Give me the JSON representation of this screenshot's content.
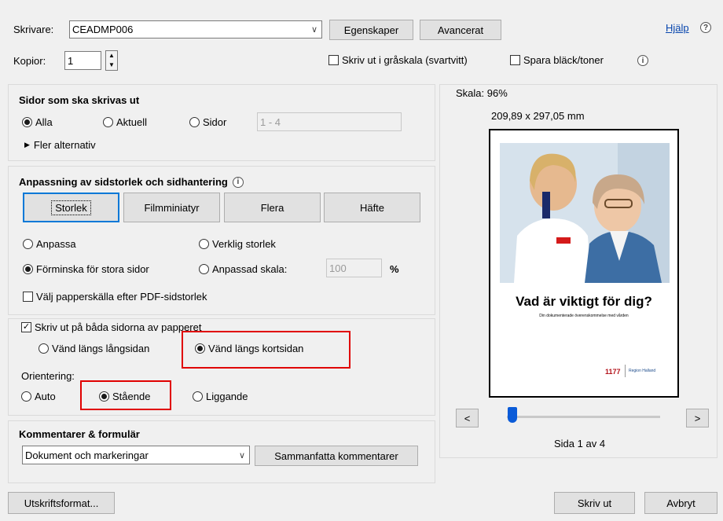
{
  "printer": {
    "label": "Skrivare:",
    "value": "CEADMP006",
    "properties_button": "Egenskaper",
    "advanced_button": "Avancerat",
    "help_link": "Hjälp",
    "help_icon": "?"
  },
  "copies": {
    "label": "Kopior:",
    "value": "1",
    "grayscale_label": "Skriv ut i gråskala (svartvitt)",
    "save_ink_label": "Spara bläck/toner",
    "info_icon": "i"
  },
  "pages_to_print": {
    "title": "Sidor som ska skrivas ut",
    "options": [
      "Alla",
      "Aktuell",
      "Sidor"
    ],
    "selected": "Alla",
    "pages_placeholder": "1 - 4",
    "more_options": "Fler alternativ"
  },
  "page_sizing": {
    "title": "Anpassning av sidstorlek och sidhantering",
    "info_icon": "i",
    "tabs": [
      "Storlek",
      "Filmminiatyr",
      "Flera",
      "Häfte"
    ],
    "active_tab": "Storlek",
    "options": {
      "fit": "Anpassa",
      "actual": "Verklig storlek",
      "shrink": "Förminska för stora sidor",
      "custom": "Anpassad skala:"
    },
    "selected": "Förminska för stora sidor",
    "custom_scale_value": "100",
    "percent": "%",
    "paper_source_label": "Välj papperskälla efter PDF-sidstorlek"
  },
  "duplex": {
    "label": "Skriv ut på båda sidorna av papperet",
    "checked": true,
    "flip_long": "Vänd längs långsidan",
    "flip_short": "Vänd längs kortsidan",
    "selected": "Vänd längs kortsidan"
  },
  "orientation": {
    "label": "Orientering:",
    "options": [
      "Auto",
      "Stående",
      "Liggande"
    ],
    "selected": "Stående"
  },
  "comments": {
    "title": "Kommentarer & formulär",
    "value": "Dokument och markeringar",
    "summarize_button": "Sammanfatta kommentarer"
  },
  "preview": {
    "scale": "Skala: 96%",
    "dimensions": "209,89 x 297,05 mm",
    "headline": "Vad är viktigt för dig?",
    "subline": "Din dokumenterade överenskommelse med vården",
    "logo_1177": "1177",
    "logo_region": "Region Halland",
    "prev_button": "<",
    "next_button": ">",
    "page_info": "Sida 1 av 4",
    "slider_position": 0.0
  },
  "footer": {
    "page_setup_button": "Utskriftsformat...",
    "print_button": "Skriv ut",
    "cancel_button": "Avbryt"
  },
  "colors": {
    "highlight": "#e00000",
    "accent": "#0078d7"
  }
}
